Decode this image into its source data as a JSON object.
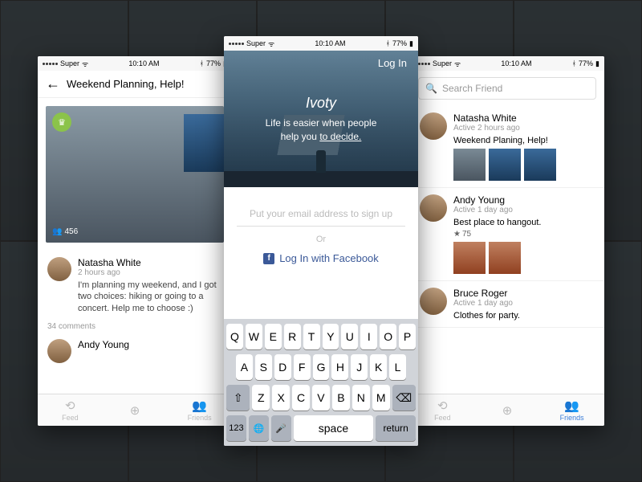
{
  "status": {
    "carrier": "Super",
    "time": "10:10 AM",
    "battery": "77%",
    "bt": "✱",
    "wifi": "✓"
  },
  "left": {
    "title": "Weekend Planning, Help!",
    "votes": "456",
    "author": {
      "name": "Natasha White",
      "time": "2 hours ago"
    },
    "text": "I'm planning my weekend, and I got two choices: hiking or going to a concert. Help me to choose :)",
    "comments": "34 comments",
    "reply": {
      "name": "Andy Young"
    },
    "tabs": {
      "feed": "Feed",
      "add": "",
      "friends": "Friends"
    }
  },
  "center": {
    "login": "Log In",
    "brand": "Ivoty",
    "tagline_a": "Life is easier when people",
    "tagline_b": "help you ",
    "tagline_c": "to decide.",
    "email_ph": "Put your email address to sign up",
    "or": "Or",
    "fb": "Log In with Facebook",
    "keys_r1": [
      "Q",
      "W",
      "E",
      "R",
      "T",
      "Y",
      "U",
      "I",
      "O",
      "P"
    ],
    "keys_r2": [
      "A",
      "S",
      "D",
      "F",
      "G",
      "H",
      "J",
      "K",
      "L"
    ],
    "keys_r3": [
      "Z",
      "X",
      "C",
      "V",
      "B",
      "N",
      "M"
    ],
    "k123": "123",
    "space": "space",
    "return": "return"
  },
  "right": {
    "search_ph": "Search Friend",
    "f1": {
      "name": "Natasha White",
      "active": "Active 2 hours ago",
      "title": "Weekend Planing, Help!"
    },
    "f2": {
      "name": "Andy Young",
      "active": "Active 1 day ago",
      "title": "Best place to hangout.",
      "stars": "75"
    },
    "f3": {
      "name": "Bruce Roger",
      "active": "Active 1 day ago",
      "title": "Clothes for party."
    },
    "tabs": {
      "feed": "Feed",
      "add": "",
      "friends": "Friends"
    }
  }
}
